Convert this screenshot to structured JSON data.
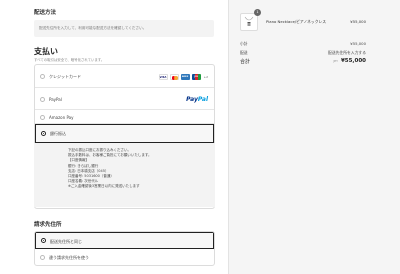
{
  "shipping": {
    "title": "配送方法",
    "placeholder": "配送先住所を入力して、利用可能な配送方法を確認してください。"
  },
  "payment": {
    "title": "支払い",
    "subtitle": "すべての取引は安全で、暗号化されています。",
    "options": [
      {
        "label": "クレジットカード",
        "selected": false,
        "icons": [
          "visa-icon",
          "mastercard-icon",
          "amex-icon",
          "jcb-icon"
        ],
        "more": "+2"
      },
      {
        "label": "PayPal",
        "selected": false,
        "logo": {
          "part1": "Pay",
          "part2": "Pal"
        }
      },
      {
        "label": "Amazon Pay",
        "selected": false
      },
      {
        "label": "銀行振込",
        "selected": true
      }
    ],
    "bank_info": [
      "下記の振込口座にお振り込みください。",
      "振込手数料は、お客様ご負担にてお願いいたします。",
      "【口座情報】",
      "銀行: きらぼし銀行",
      "支店: 日本橋支店（045）",
      "口座番号: 5031600（普通）",
      "口座名義: 次世代ル",
      "※ご入金確認後3営業日以内に発送いたします"
    ]
  },
  "billing": {
    "title": "請求先住所",
    "options": [
      {
        "label": "配送先住所と同じ",
        "selected": true
      },
      {
        "label": "違う請求先住所を使う",
        "selected": false
      }
    ]
  },
  "summary": {
    "item": {
      "name": "Piano Necklace/ピアノネックレス",
      "price": "¥55,000",
      "quantity": "1"
    },
    "subtotal_label": "小計",
    "subtotal": "¥55,000",
    "shipping_label": "配送",
    "shipping_value": "配送先住所を入力する",
    "total_label": "合計",
    "currency": "JPY",
    "total": "¥55,000"
  },
  "colors": {
    "paypal_dark": "#003087",
    "paypal_light": "#009cde",
    "selected_border": "#222222"
  }
}
